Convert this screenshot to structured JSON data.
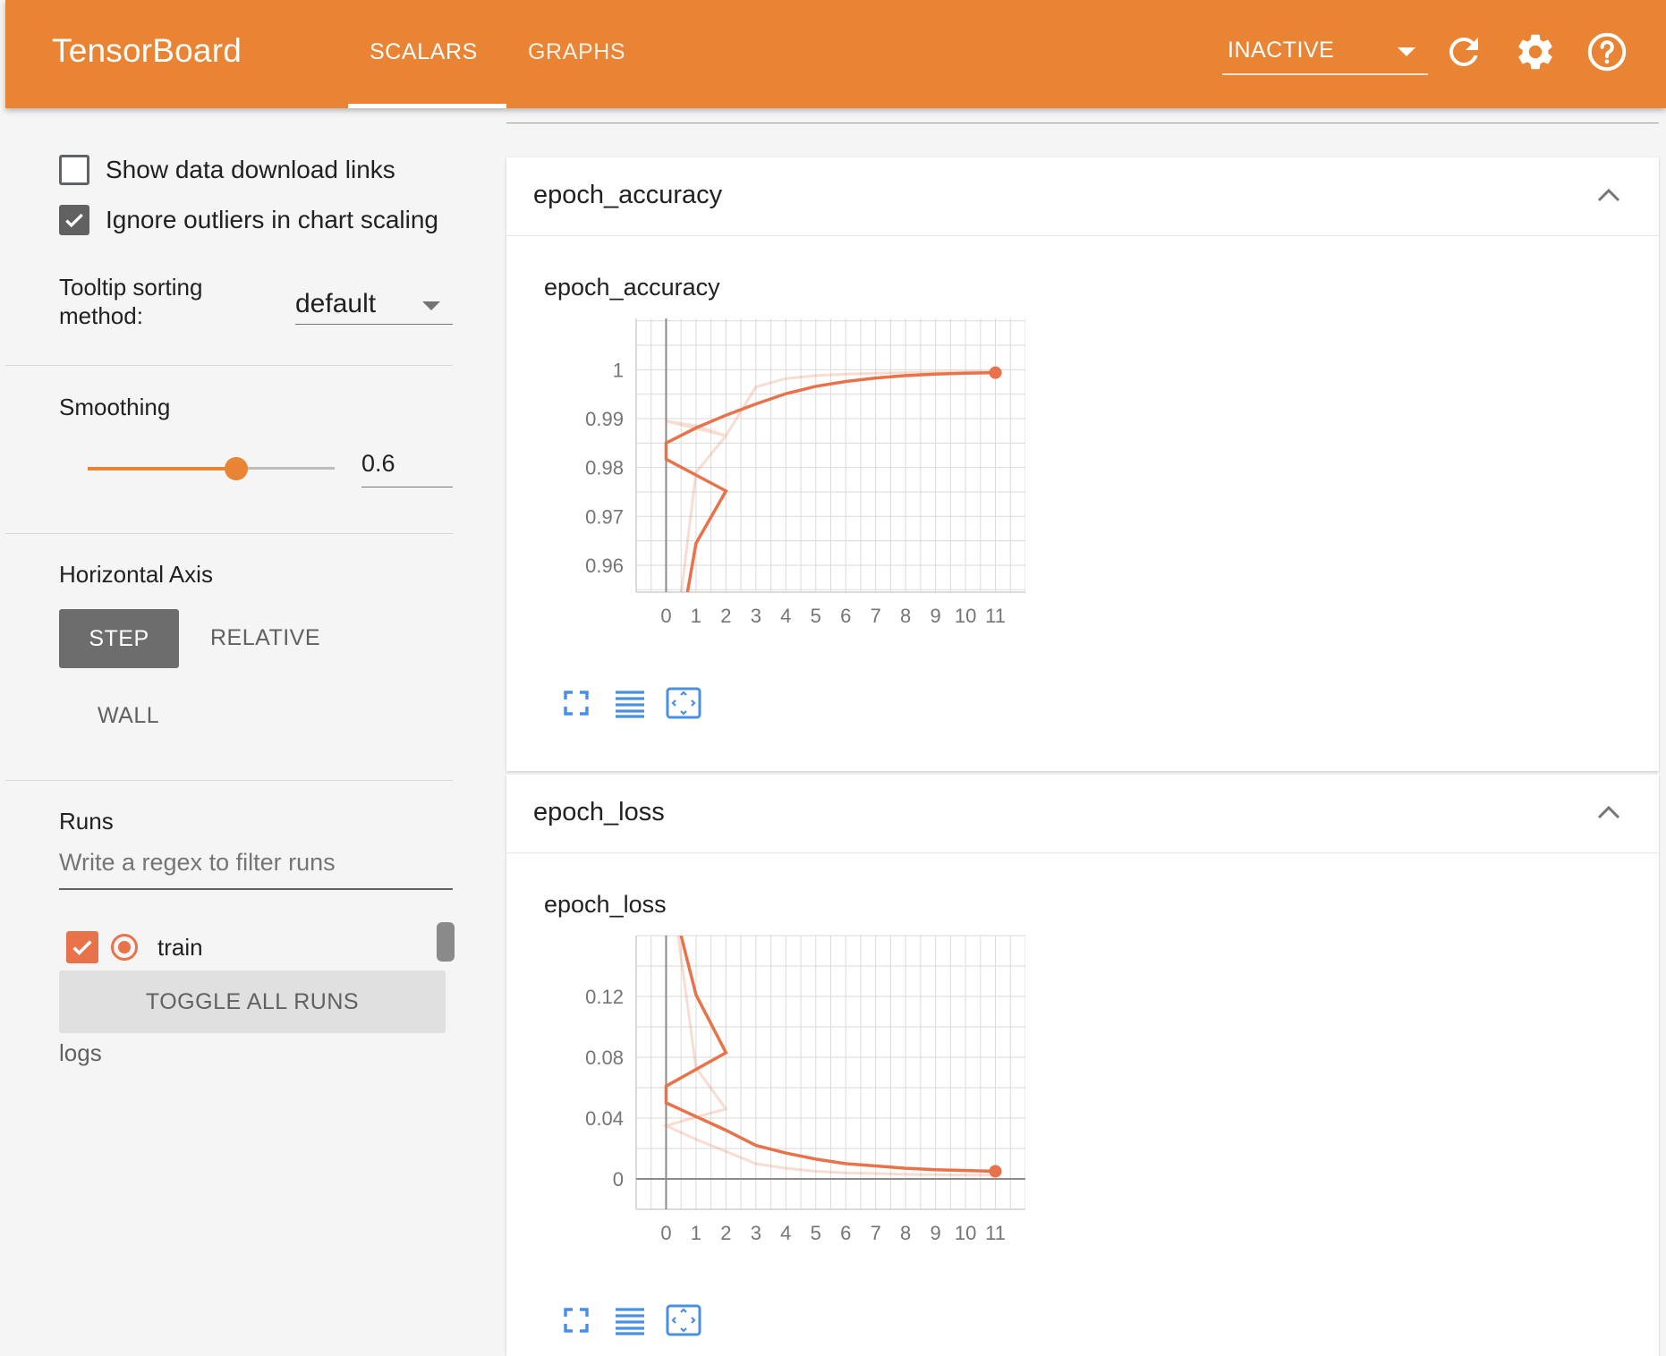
{
  "header": {
    "brand": "TensorBoard",
    "tabs": [
      {
        "label": "SCALARS",
        "active": true
      },
      {
        "label": "GRAPHS",
        "active": false
      }
    ],
    "status_select": "INACTIVE",
    "icons": [
      "reload-icon",
      "settings-gear-icon",
      "help-icon"
    ]
  },
  "sidebar": {
    "show_download_links": {
      "label": "Show data download links",
      "checked": false
    },
    "ignore_outliers": {
      "label": "Ignore outliers in chart scaling",
      "checked": true
    },
    "tooltip_sorting": {
      "label": "Tooltip sorting method:",
      "value": "default"
    },
    "smoothing": {
      "label": "Smoothing",
      "value": "0.6",
      "fraction": 0.6
    },
    "horizontal_axis": {
      "label": "Horizontal Axis",
      "options": [
        "STEP",
        "RELATIVE",
        "WALL"
      ],
      "selected": "STEP"
    },
    "runs": {
      "label": "Runs",
      "filter_placeholder": "Write a regex to filter runs",
      "items": [
        {
          "name": "train",
          "checked": true,
          "color": "#e8734a"
        }
      ],
      "toggle_all_label": "TOGGLE ALL RUNS",
      "logdir": "logs"
    }
  },
  "colors": {
    "accent": "#e88434",
    "run": "#e8734a",
    "icon_blue": "#4a90e2"
  },
  "cards": [
    {
      "title": "epoch_accuracy",
      "chart_data": {
        "type": "line",
        "title": "epoch_accuracy",
        "x": [
          0,
          1,
          2,
          3,
          4,
          5,
          6,
          7,
          8,
          9,
          10,
          11
        ],
        "xlim": [
          -1,
          12
        ],
        "ylim": [
          0.9545,
          1.0105
        ],
        "yticks": [
          0.96,
          0.97,
          0.98,
          0.99,
          1
        ],
        "ytick_labels": [
          "0.96",
          "0.97",
          "0.98",
          "0.99",
          "1"
        ],
        "grid": true,
        "series": [
          {
            "kind": "raw",
            "values": [
              0.9895,
              0.9885,
              0.9865,
              0.9965,
              0.9982,
              0.9988,
              0.9991,
              0.9993,
              0.9994,
              0.9995,
              0.9996,
              0.9996
            ]
          },
          {
            "kind": "smoothed",
            "values": [
              0.9822,
              0.9881,
              0.9907,
              0.993,
              0.9951,
              0.9966,
              0.9976,
              0.9983,
              0.9988,
              0.9991,
              0.9993,
              0.9994
            ]
          }
        ],
        "smoothed_line_extra": [
          [
            0.7,
            0.954
          ],
          [
            1,
            0.9645
          ],
          [
            2,
            0.9752
          ],
          [
            0,
            0.9817
          ],
          [
            0,
            0.985
          ]
        ],
        "raw_line_extra": [
          [
            0.5,
            0.954
          ],
          [
            1,
            0.979
          ],
          [
            2,
            0.9865
          ],
          [
            0,
            0.9895
          ]
        ]
      }
    },
    {
      "title": "epoch_loss",
      "chart_data": {
        "type": "line",
        "title": "epoch_loss",
        "x": [
          0,
          1,
          2,
          3,
          4,
          5,
          6,
          7,
          8,
          9,
          10,
          11
        ],
        "xlim": [
          -1,
          12
        ],
        "ylim": [
          -0.02,
          0.16
        ],
        "yticks": [
          0,
          0.04,
          0.08,
          0.12
        ],
        "ytick_labels": [
          "0",
          "0.04",
          "0.08",
          "0.12"
        ],
        "grid": true,
        "series": [
          {
            "kind": "raw",
            "values": [
              0.035,
              0.026,
              0.018,
              0.01,
              0.007,
              0.005,
              0.004,
              0.0035,
              0.003,
              0.0028,
              0.0026,
              0.0025
            ]
          },
          {
            "kind": "smoothed",
            "values": [
              0.05,
              0.041,
              0.032,
              0.022,
              0.017,
              0.013,
              0.01,
              0.0085,
              0.007,
              0.006,
              0.0055,
              0.005
            ]
          }
        ],
        "smoothed_line_extra": [
          [
            0.5,
            0.16
          ],
          [
            1,
            0.121
          ],
          [
            2,
            0.083
          ],
          [
            0,
            0.061
          ],
          [
            0,
            0.05
          ]
        ],
        "raw_line_extra": [
          [
            0.4,
            0.16
          ],
          [
            1,
            0.073
          ],
          [
            2,
            0.046
          ],
          [
            0,
            0.035
          ]
        ]
      }
    }
  ]
}
